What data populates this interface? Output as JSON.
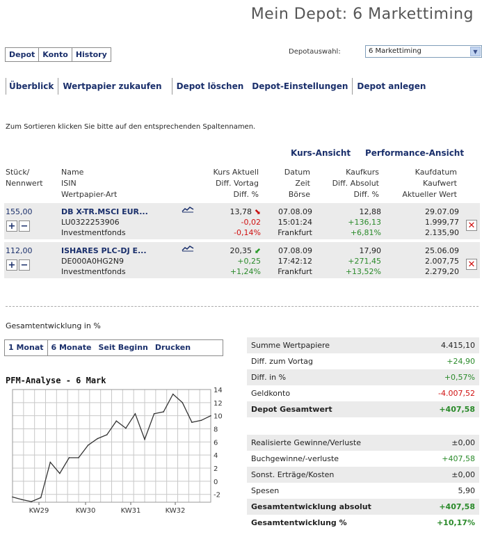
{
  "page_title": "Mein Depot: 6 Markettiming",
  "tabs": [
    "Depot",
    "Konto",
    "History"
  ],
  "depot_select": {
    "label": "Depotauswahl:",
    "value": "6 Markettiming"
  },
  "actions": [
    "Überblick",
    "Wertpapier zukaufen",
    "Depot löschen",
    "Depot-Einstellungen",
    "Depot anlegen"
  ],
  "sort_hint": "Zum Sortieren klicken Sie bitte auf den entsprechenden Spaltennamen.",
  "view_links": {
    "kurs": "Kurs-Ansicht",
    "performance": "Performance-Ansicht"
  },
  "columns": {
    "c1": [
      "Stück/",
      "Nennwert"
    ],
    "c2": [
      "Name",
      "ISIN",
      "Wertpapier-Art"
    ],
    "c3": [
      "Kurs Aktuell",
      "Diff. Vortag",
      "Diff. %"
    ],
    "c4": [
      "Datum",
      "Zeit",
      "Börse"
    ],
    "c5": [
      "Kaufkurs",
      "Diff. Absolut",
      "Diff. %"
    ],
    "c6": [
      "Kaufdatum",
      "Kaufwert",
      "Aktueller Wert"
    ]
  },
  "positions": [
    {
      "qty": "155,00",
      "name": "DB X-TR.MSCI EUR...",
      "isin": "LU0322253906",
      "type": "Investmentfonds",
      "kurs": "13,78",
      "diff_vortag": "-0,02",
      "diff_pct": "-0,14%",
      "datum": "07.08.09",
      "zeit": "15:01:24",
      "boerse": "Frankfurt",
      "kaufkurs": "12,88",
      "diff_abs": "+136,13",
      "diff_pct2": "+6,81%",
      "kaufdatum": "29.07.09",
      "kaufwert": "1.999,77",
      "akt_wert": "2.135,90",
      "trend": "down"
    },
    {
      "qty": "112,00",
      "name": "ISHARES PLC-DJ E...",
      "isin": "DE000A0HG2N9",
      "type": "Investmentfonds",
      "kurs": "20,35",
      "diff_vortag": "+0,25",
      "diff_pct": "+1,24%",
      "datum": "07.08.09",
      "zeit": "17:42:12",
      "boerse": "Frankfurt",
      "kaufkurs": "17,90",
      "diff_abs": "+271,45",
      "diff_pct2": "+13,52%",
      "kaufdatum": "25.06.09",
      "kaufwert": "2.007,75",
      "akt_wert": "2.279,20",
      "trend": "up"
    }
  ],
  "gesamt_title": "Gesamtentwicklung in %",
  "perf_tabs": [
    "1 Monat",
    "6 Monate",
    "Seit Beginn",
    "Drucken"
  ],
  "chart_data": {
    "type": "line",
    "title": "PFM-Analyse - 6 Mark",
    "x_tick_labels": [
      "KW29",
      "KW30",
      "KW31",
      "KW32"
    ],
    "y_ticks": [
      -2,
      0,
      2,
      4,
      6,
      8,
      10,
      12,
      14
    ],
    "ylim": [
      -3.2,
      14
    ],
    "grid": true,
    "values": [
      -2.4,
      -2.8,
      -3.1,
      -2.5,
      2.9,
      1.2,
      3.6,
      3.6,
      5.5,
      6.5,
      7.1,
      9.2,
      8.1,
      10.3,
      6.4,
      10.3,
      10.6,
      13.3,
      12.0,
      9.0,
      9.3,
      10.0
    ]
  },
  "summary_top": [
    {
      "label": "Summe Wertpapiere",
      "value": "4.415,10",
      "cls": ""
    },
    {
      "label": "Diff. zum Vortag",
      "value": "+24,90",
      "cls": "pos"
    },
    {
      "label": "Diff. in %",
      "value": "+0,57%",
      "cls": "pos"
    },
    {
      "label": "Geldkonto",
      "value": "-4.007,52",
      "cls": "neg"
    },
    {
      "label": "Depot Gesamtwert",
      "value": "+407,58",
      "cls": "pos"
    }
  ],
  "summary_bottom": [
    {
      "label": "Realisierte Gewinne/Verluste",
      "value": "±0,00",
      "cls": ""
    },
    {
      "label": "Buchgewinne/-verluste",
      "value": "+407,58",
      "cls": "pos"
    },
    {
      "label": "Sonst. Erträge/Kosten",
      "value": "±0,00",
      "cls": ""
    },
    {
      "label": "Spesen",
      "value": "5,90",
      "cls": ""
    },
    {
      "label": "Gesamtentwicklung absolut",
      "value": "+407,58",
      "cls": "pos"
    },
    {
      "label": "Gesamtentwicklung %",
      "value": "+10,17%",
      "cls": "pos"
    }
  ]
}
